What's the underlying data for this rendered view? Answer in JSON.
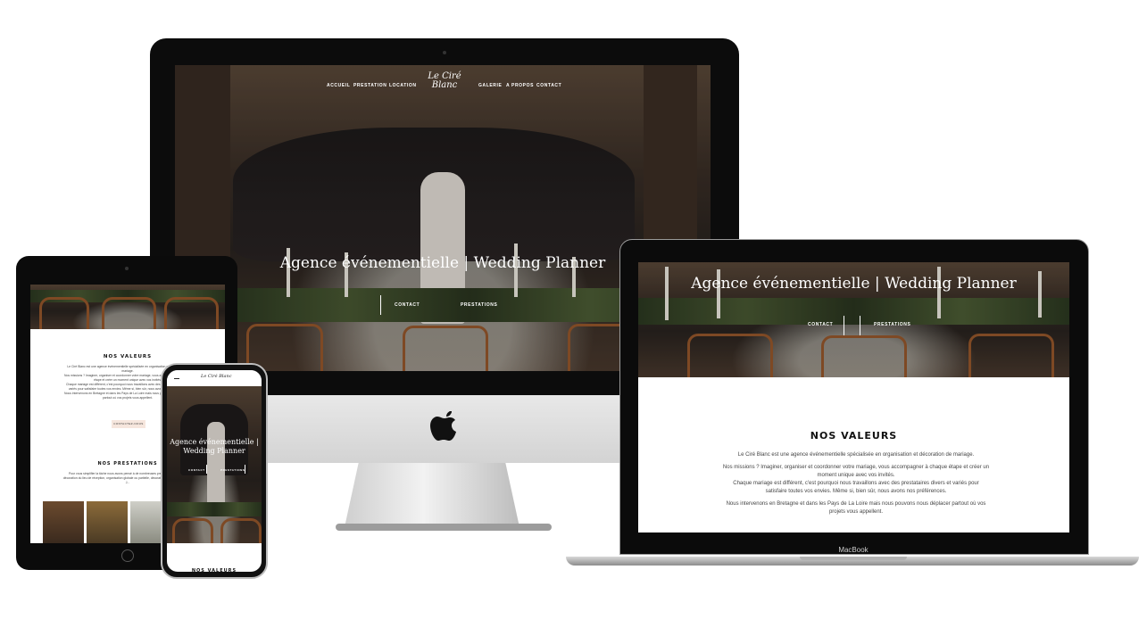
{
  "site": {
    "logo": "Le Ciré Blanc",
    "nav": [
      "ACCUEIL",
      "PRESTATION",
      "LOCATION",
      "GALERIE",
      "A PROPOS",
      "CONTACT"
    ],
    "hero_title": "Agence événementielle | Wedding Planner",
    "hero_title_mobile_1": "Agence événementielle |",
    "hero_title_mobile_2": "Wedding Planner",
    "btn_contact": "CONTACT",
    "btn_prestations": "PRESTATIONS",
    "values_heading": "NOS VALEURS",
    "values_p1": "Le Ciré Blanc est une agence événementielle spécialisée en organisation et décoration de mariage.",
    "values_p2": "Nos missions ? Imaginer, organiser et coordonner votre mariage, vous accompagner à chaque étape et créer un moment unique avec vos invités.",
    "values_p3": "Chaque mariage est différent, c'est pourquoi nous travaillons avec des prestataires divers et variés pour satisfaire toutes vos envies. Même si, bien sûr, nous avons nos préférences.",
    "values_p4": "Nous intervenons en Bretagne et dans les Pays de La Loire mais nous pouvons nous déplacer partout où vos projets vous appellent.",
    "contact_cta": "CONTACTEZ-NOUS",
    "prestations_heading": "NOS PRESTATIONS",
    "prestations_p": "Pour vous simplifier la tâche nous avons pensé à de nombreuses prestations : planning, décoration du lieu de réception, organisation globale ou partielle, décoration, coordination le jour J..."
  },
  "laptop": {
    "brand": "MacBook"
  },
  "colors": {
    "device_black": "#0b0b0b",
    "cta_bg": "#f6e6dd",
    "apple_logo": "#111111"
  },
  "icons": [
    "apple-logo-icon",
    "camera-dot-icon",
    "home-button-icon"
  ]
}
